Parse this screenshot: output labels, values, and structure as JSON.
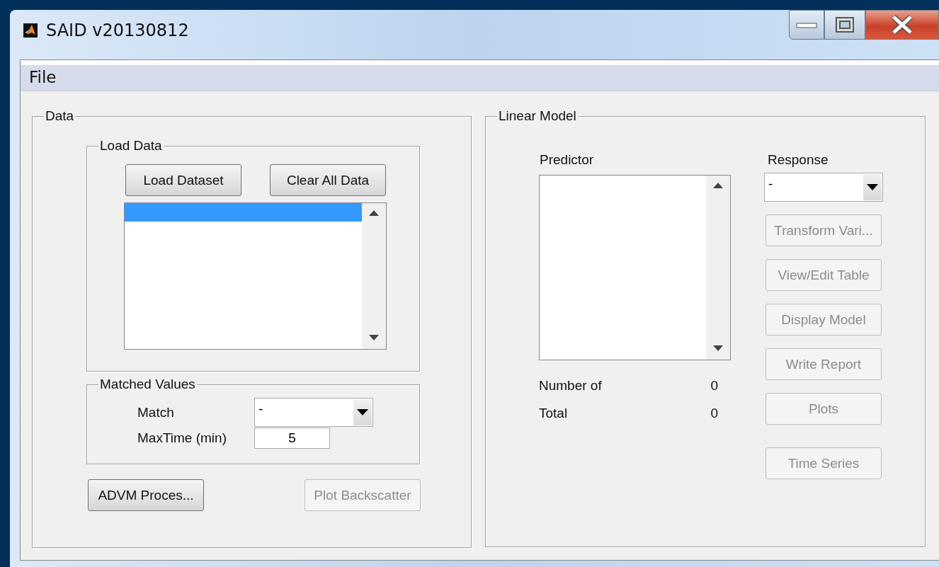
{
  "window": {
    "title": "SAID v20130812"
  },
  "menu": [
    {
      "label": "File"
    }
  ],
  "data_panel": {
    "title": "Data",
    "load_data": {
      "title": "Load Data",
      "buttons": [
        {
          "label": "Load Dataset",
          "disabled": false
        },
        {
          "label": "Clear All Data",
          "disabled": false
        }
      ],
      "list": {
        "items": [
          {
            "selected": true
          }
        ]
      }
    },
    "matched_values": {
      "title": "Matched Values",
      "match": {
        "label": "Match",
        "value": "-"
      },
      "max_time": {
        "label": "MaxTime (min)",
        "value": "5"
      }
    },
    "buttons": [
      {
        "label": "ADVM Proces...",
        "disabled": false
      },
      {
        "label": "Plot Backscatter",
        "disabled": true
      }
    ]
  },
  "linear_model": {
    "title": "Linear Model",
    "predictor": {
      "label": "Predictor"
    },
    "response": {
      "label": "Response",
      "value": "-"
    },
    "stats": [
      {
        "label": "Number of",
        "value": "0"
      },
      {
        "label": "Total",
        "value": "0"
      }
    ],
    "buttons": [
      {
        "label": "Transform Vari...",
        "disabled": true
      },
      {
        "label": "View/Edit Table",
        "disabled": true
      },
      {
        "label": "Display Model",
        "disabled": true
      },
      {
        "label": "Write Report",
        "disabled": true
      },
      {
        "label": "Plots",
        "disabled": true
      },
      {
        "label": "Time Series",
        "disabled": true
      }
    ]
  }
}
